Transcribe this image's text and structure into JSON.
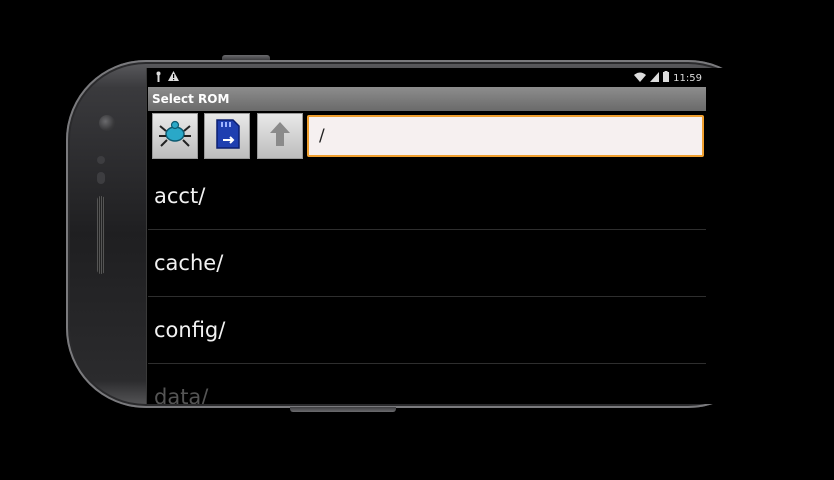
{
  "status_bar": {
    "left_icons": [
      "usb-debug-icon",
      "warning-icon"
    ],
    "right_icons": [
      "wifi-icon",
      "signal-icon",
      "battery-icon"
    ],
    "time": "11:59"
  },
  "title_bar": {
    "title": "Select ROM"
  },
  "toolbar": {
    "buttons": [
      "bug-icon",
      "sd-card-icon",
      "up-arrow-icon"
    ],
    "path_value": "/"
  },
  "file_list": {
    "items": [
      {
        "label": "acct/"
      },
      {
        "label": "cache/"
      },
      {
        "label": "config/"
      },
      {
        "label": "data/"
      }
    ]
  },
  "colors": {
    "accent_border": "#f0a030",
    "title_bar_bg": "#7a7a7a",
    "screen_bg": "#000000"
  }
}
